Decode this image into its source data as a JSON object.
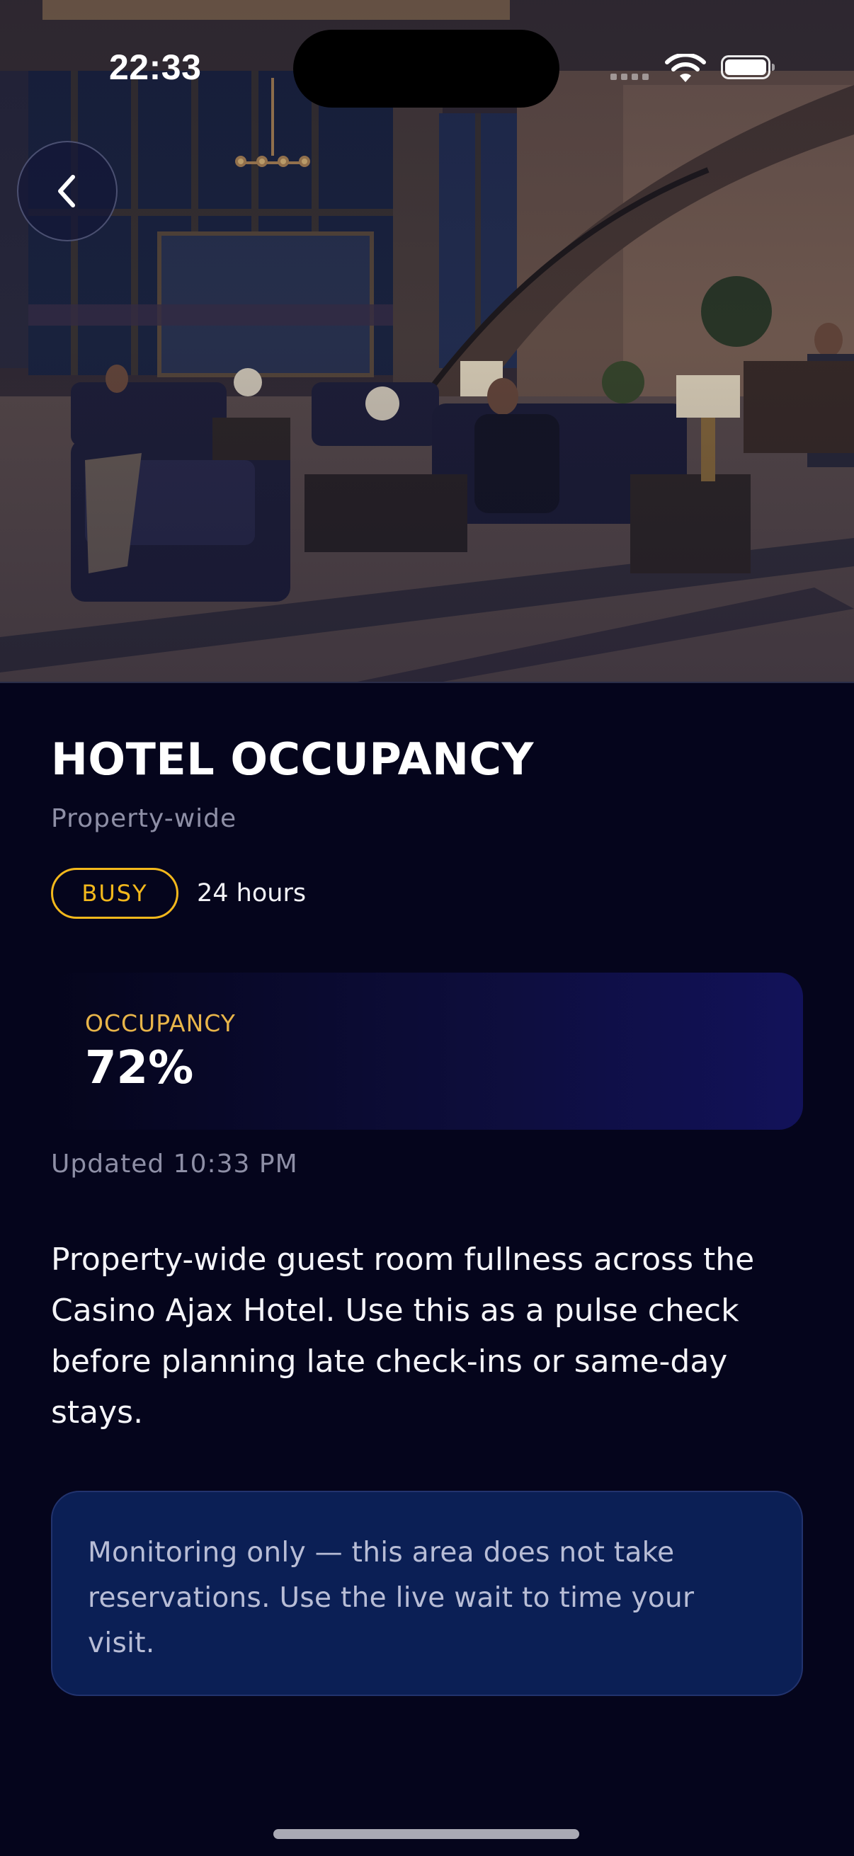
{
  "status_bar": {
    "time": "22:33"
  },
  "hero": {
    "image_subject": "hotel-lobby-photo"
  },
  "back_button": {
    "icon": "chevron-left-icon"
  },
  "header": {
    "title": "HOTEL OCCUPANCY",
    "subtitle": "Property-wide"
  },
  "badges": {
    "status": "BUSY",
    "hours": "24 hours"
  },
  "occupancy": {
    "label": "OCCUPANCY",
    "value": "72%"
  },
  "updated": "Updated 10:33 PM",
  "description": "Property-wide guest room fullness across the Casino Ajax Hotel. Use this as a pulse check before planning late check-ins or same-day stays.",
  "notice": "Monitoring only — this area does not take reservations. Use the live wait to time your visit.",
  "colors": {
    "background": "#05051c",
    "accent_yellow": "#f3b81c",
    "occupancy_label": "#e8b54a",
    "notice_bg": "#0b1f55",
    "muted_text": "#8e8fa6"
  }
}
